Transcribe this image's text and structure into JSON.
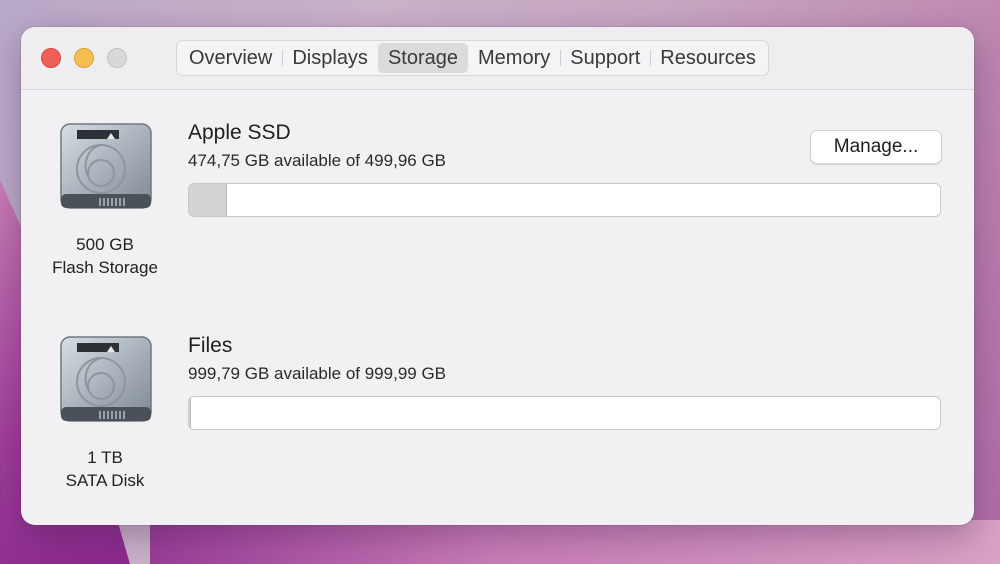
{
  "window": {
    "tabs": [
      {
        "label": "Overview"
      },
      {
        "label": "Displays"
      },
      {
        "label": "Storage"
      },
      {
        "label": "Memory"
      },
      {
        "label": "Support"
      },
      {
        "label": "Resources"
      }
    ],
    "active_tab": "Storage"
  },
  "disks": [
    {
      "name": "Apple SSD",
      "available_text": "474,75 GB available of 499,96 GB",
      "capacity_line": "500 GB",
      "type_line": "Flash Storage",
      "used_fraction": 0.05,
      "icon": "hard-drive-icon"
    },
    {
      "name": "Files",
      "available_text": "999,79 GB available of 999,99 GB",
      "capacity_line": "1 TB",
      "type_line": "SATA Disk",
      "used_fraction": 0.0002,
      "icon": "hard-drive-icon"
    }
  ],
  "manage_button": {
    "label": "Manage..."
  },
  "colors": {
    "close": "#ee5f56",
    "minimize": "#f5be4f",
    "zoom_inactive": "#d9d7da",
    "window_bg": "#f1f0f2",
    "bar_used": "#d3d2d4"
  }
}
